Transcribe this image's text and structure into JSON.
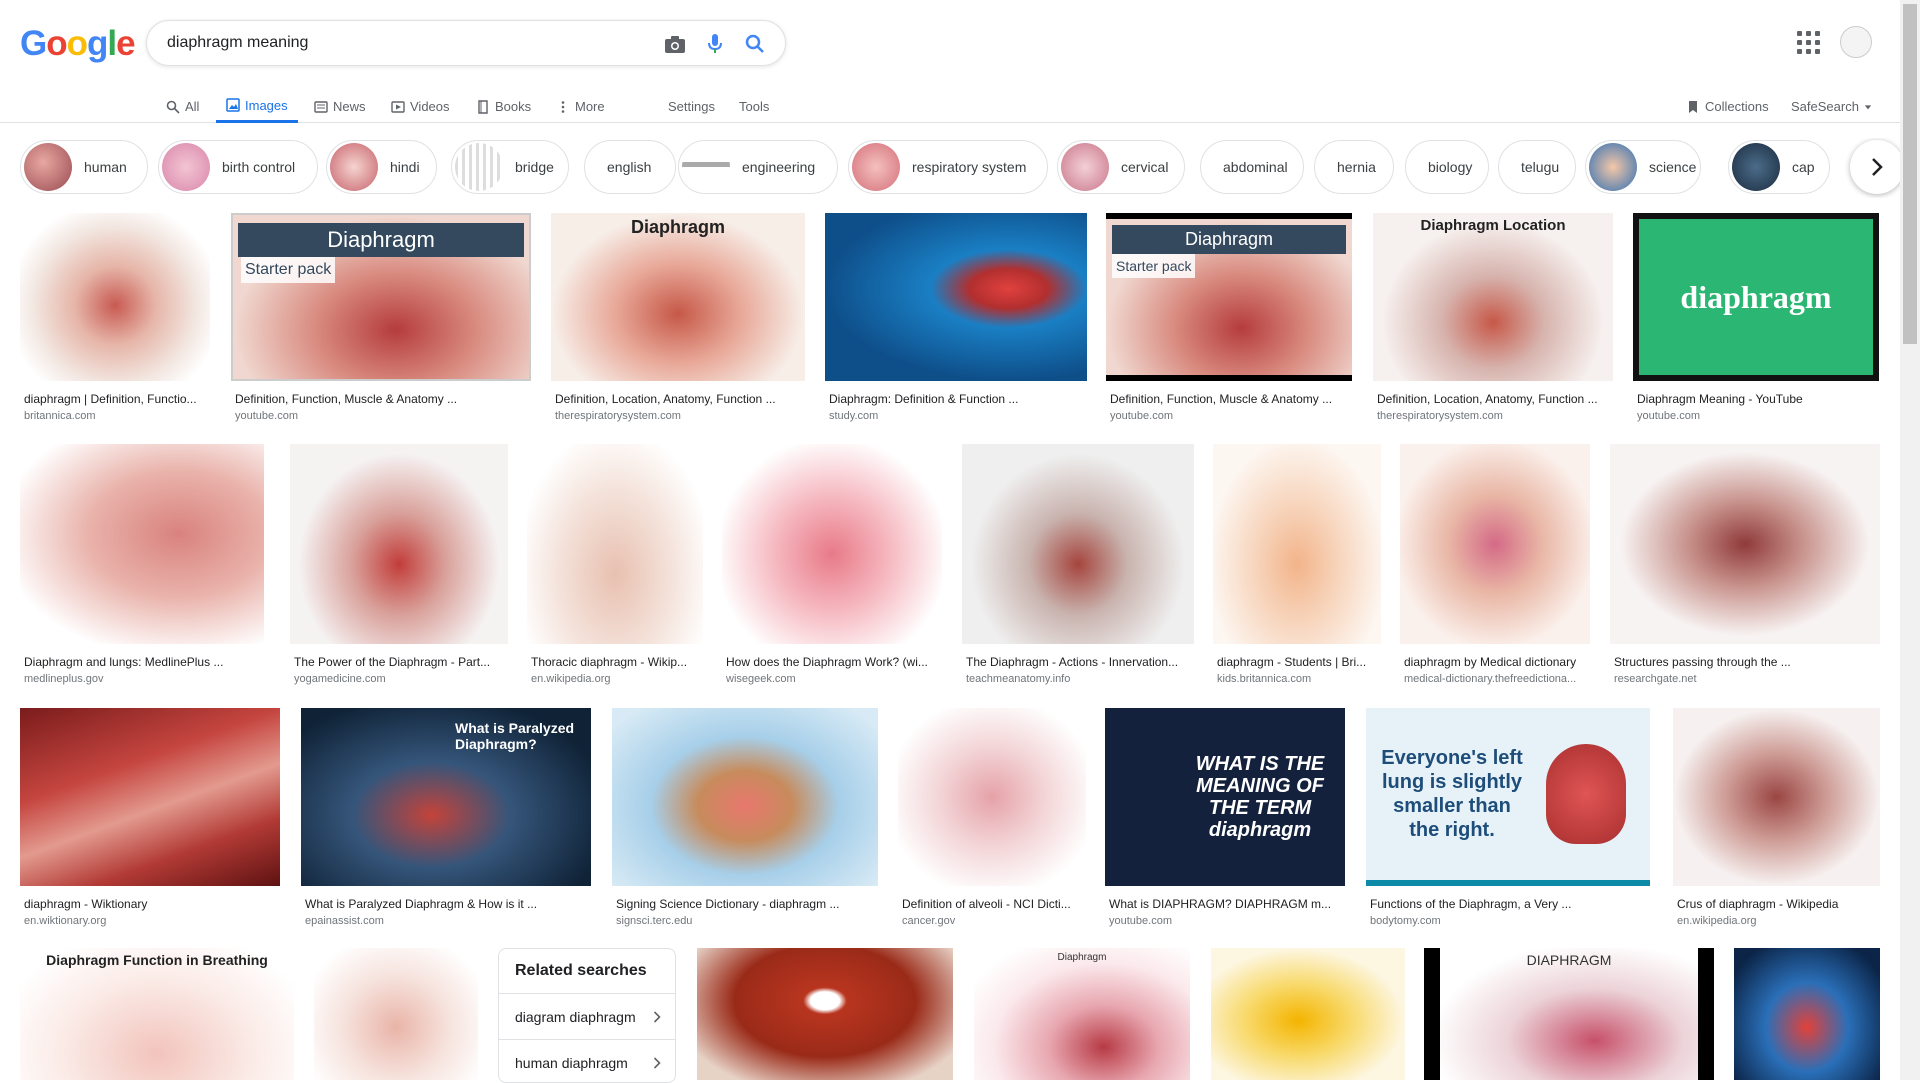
{
  "logo": {
    "letters": [
      "G",
      "o",
      "o",
      "g",
      "l",
      "e"
    ]
  },
  "search": {
    "value": "diaphragm meaning"
  },
  "tabs": {
    "all": "All",
    "images": "Images",
    "news": "News",
    "videos": "Videos",
    "books": "Books",
    "more": "More",
    "settings": "Settings",
    "tools": "Tools",
    "collections": "Collections",
    "safesearch": "SafeSearch"
  },
  "chips": [
    "human",
    "birth control",
    "hindi",
    "bridge",
    "english",
    "engineering",
    "respiratory system",
    "cervical",
    "abdominal",
    "hernia",
    "biology",
    "telugu",
    "science",
    "cap"
  ],
  "results": [
    {
      "title": "diaphragm | Definition, Functio...",
      "src": "britannica.com"
    },
    {
      "title": "Definition, Function, Muscle & Anatomy ...",
      "src": "youtube.com",
      "img_text": "Diaphragm",
      "img_sub": "Starter pack"
    },
    {
      "title": "Definition, Location, Anatomy, Function ...",
      "src": "therespiratorysystem.com",
      "img_text": "Diaphragm"
    },
    {
      "title": "Diaphragm: Definition & Function ...",
      "src": "study.com"
    },
    {
      "title": "Definition, Function, Muscle & Anatomy ...",
      "src": "youtube.com",
      "img_text": "Diaphragm",
      "img_sub": "Starter pack"
    },
    {
      "title": "Definition, Location, Anatomy, Function ...",
      "src": "therespiratorysystem.com",
      "img_text": "Diaphragm Location"
    },
    {
      "title": "Diaphragm Meaning - YouTube",
      "src": "youtube.com",
      "img_text": "diaphragm"
    },
    {
      "title": "Diaphragm and lungs: MedlinePlus ...",
      "src": "medlineplus.gov"
    },
    {
      "title": "The Power of the Diaphragm - Part...",
      "src": "yogamedicine.com"
    },
    {
      "title": "Thoracic diaphragm - Wikip...",
      "src": "en.wikipedia.org"
    },
    {
      "title": "How does the Diaphragm Work? (wi...",
      "src": "wisegeek.com"
    },
    {
      "title": "The Diaphragm - Actions - Innervation...",
      "src": "teachmeanatomy.info"
    },
    {
      "title": "diaphragm - Students | Bri...",
      "src": "kids.britannica.com"
    },
    {
      "title": "diaphragm by Medical dictionary",
      "src": "medical-dictionary.thefreedictiona..."
    },
    {
      "title": "Structures passing through the ...",
      "src": "researchgate.net"
    },
    {
      "title": "diaphragm - Wiktionary",
      "src": "en.wiktionary.org"
    },
    {
      "title": "What is Paralyzed Diaphragm & How is it ...",
      "src": "epainassist.com",
      "img_text": "What is Paralyzed Diaphragm?"
    },
    {
      "title": "Signing Science Dictionary - diaphragm ...",
      "src": "signsci.terc.edu"
    },
    {
      "title": "Definition of alveoli - NCI Dicti...",
      "src": "cancer.gov"
    },
    {
      "title": "What is DIAPHRAGM? DIAPHRAGM m...",
      "src": "youtube.com",
      "img_text": "WHAT IS THE MEANING OF THE TERM diaphragm"
    },
    {
      "title": "Functions of the Diaphragm, a Very ...",
      "src": "bodytomy.com",
      "img_text": "Everyone's left lung is slightly smaller than the right."
    },
    {
      "title": "Crus of diaphragm - Wikipedia",
      "src": "en.wikipedia.org"
    },
    {
      "img_text": "Diaphragm Function in Breathing"
    },
    {},
    {},
    {
      "img_text": "Diaphragm"
    },
    {},
    {
      "img_text": "DIAPHRAGM"
    },
    {}
  ],
  "related": {
    "heading": "Related searches",
    "items": [
      "diagram diaphragm",
      "human diaphragm"
    ]
  },
  "colors": {
    "accent": "#1a73e8",
    "blue": "#4285f4",
    "red": "#ea4335",
    "yellow": "#fbbc05",
    "green": "#34a853"
  }
}
